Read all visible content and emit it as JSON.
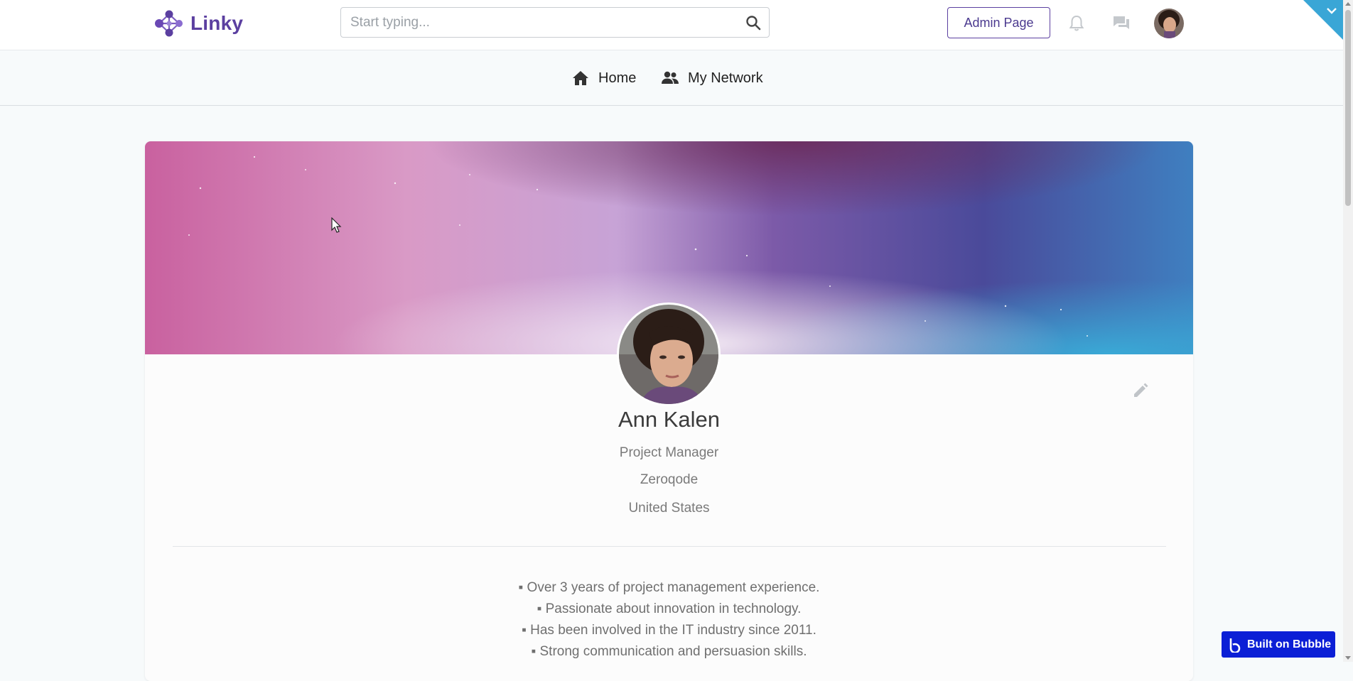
{
  "header": {
    "logo_text": "Linky",
    "search_placeholder": "Start typing...",
    "admin_button": "Admin Page",
    "icons": [
      "search-icon",
      "bell-icon",
      "chat-icon",
      "avatar"
    ]
  },
  "nav": {
    "items": [
      {
        "label": "Home",
        "icon": "home-icon"
      },
      {
        "label": "My Network",
        "icon": "people-icon"
      }
    ]
  },
  "profile": {
    "name": "Ann Kalen",
    "title": "Project Manager",
    "company": "Zeroqode",
    "location": "United States",
    "bio": [
      "▪ Over 3 years of project management experience.",
      "▪ Passionate about innovation in technology.",
      "▪ Has been involved in the IT industry since 2011.",
      "▪ Strong communication and persuasion skills."
    ]
  },
  "badge": {
    "label": "Built on Bubble"
  },
  "colors": {
    "brand": "#5b3fa0",
    "bubble": "#0c1fd6",
    "corner_tab": "#3aa6d6"
  }
}
